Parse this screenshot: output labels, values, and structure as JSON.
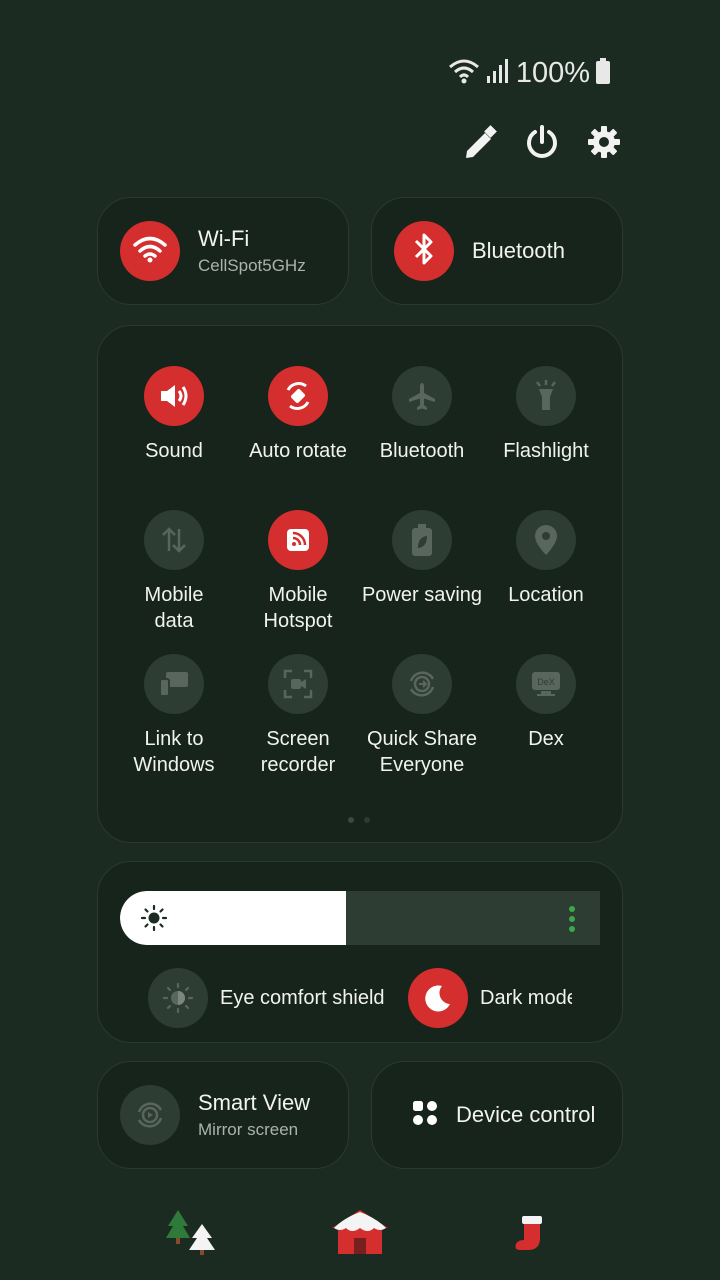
{
  "status_bar": {
    "battery_text": "100%"
  },
  "header_actions": {
    "edit": "pencil-icon",
    "power": "power-icon",
    "settings": "gear-icon"
  },
  "big_tiles": {
    "wifi": {
      "title": "Wi-Fi",
      "subtitle": "CellSpot5GHz",
      "state": "on"
    },
    "bluetooth": {
      "title": "Bluetooth",
      "state": "on"
    }
  },
  "quick_tiles": [
    {
      "label": "Sound",
      "state": "on",
      "icon": "speaker-icon"
    },
    {
      "label": "Auto rotate",
      "state": "on",
      "icon": "rotate-icon"
    },
    {
      "label": "Bluetooth",
      "state": "off",
      "icon": "airplane-icon"
    },
    {
      "label": "Flashlight",
      "state": "off",
      "icon": "flashlight-icon"
    },
    {
      "label": "Mobile\ndata",
      "state": "off",
      "icon": "data-arrows-icon"
    },
    {
      "label": "Mobile\nHotspot",
      "state": "on",
      "icon": "hotspot-icon"
    },
    {
      "label": "Power saving",
      "state": "off",
      "icon": "battery-leaf-icon"
    },
    {
      "label": "Location",
      "state": "off",
      "icon": "location-pin-icon"
    },
    {
      "label": "Link to\nWindows",
      "state": "off",
      "icon": "link-windows-icon"
    },
    {
      "label": "Screen\nrecorder",
      "state": "off",
      "icon": "screen-record-icon"
    },
    {
      "label": "Quick Share\nEveryone",
      "state": "off",
      "icon": "quick-share-icon"
    },
    {
      "label": "Dex",
      "state": "off",
      "icon": "dex-icon"
    }
  ],
  "brightness": {
    "level": 0.47
  },
  "display_toggles": {
    "eye_comfort": {
      "label": "Eye comfort shield",
      "state": "off"
    },
    "dark_mode": {
      "label": "Dark mode",
      "state": "on"
    }
  },
  "bottom_tiles": {
    "smart_view": {
      "title": "Smart View",
      "subtitle": "Mirror screen"
    },
    "device_control": {
      "title": "Device control"
    }
  },
  "nav": {
    "left": "christmas-trees-icon",
    "center": "snowy-house-icon",
    "right": "stocking-icon"
  },
  "colors": {
    "background": "#1c2b22",
    "card": "#16241b",
    "accent_on": "#d42e2e",
    "off_circle": "#2e3d34"
  }
}
